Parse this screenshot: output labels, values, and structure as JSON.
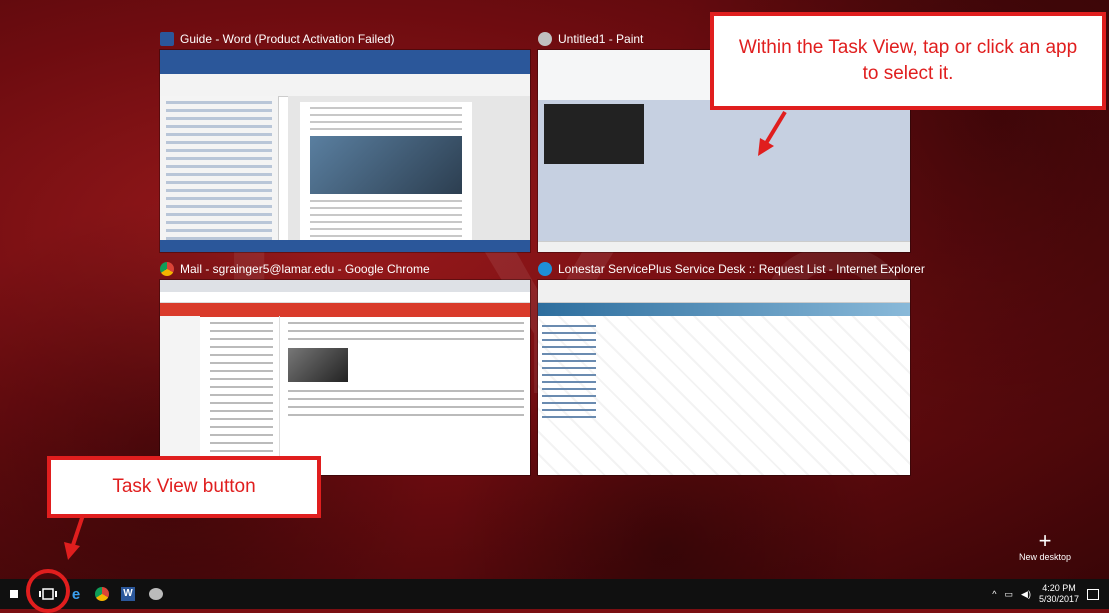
{
  "windows": [
    {
      "title": "Guide - Word (Product Activation Failed)",
      "icon": "word-icon",
      "accent": "#2b579a"
    },
    {
      "title": "Untitled1 - Paint",
      "icon": "paint-icon",
      "accent": "#f0c040"
    },
    {
      "title": "Mail - sgrainger5@lamar.edu - Google Chrome",
      "icon": "chrome-icon",
      "accent": "#d93b2b"
    },
    {
      "title": "Lonestar ServicePlus Service Desk :: Request List - Internet Explorer",
      "icon": "ie-icon",
      "accent": "#1e8fd6"
    }
  ],
  "callouts": {
    "select_app": "Within the Task View, tap or click an app to select it.",
    "task_view_button": "Task View button"
  },
  "new_desktop": {
    "label": "New desktop",
    "icon": "plus-icon"
  },
  "taskbar": {
    "items": [
      "start-icon",
      "task-view-icon",
      "edge-icon",
      "chrome-icon",
      "word-icon",
      "paint-icon"
    ],
    "clock_time": "4:20 PM",
    "clock_date": "5/30/2017"
  },
  "colors": {
    "callout_red": "#e01e1e",
    "taskbar": "#101010",
    "desktop": "#7a0e12"
  }
}
